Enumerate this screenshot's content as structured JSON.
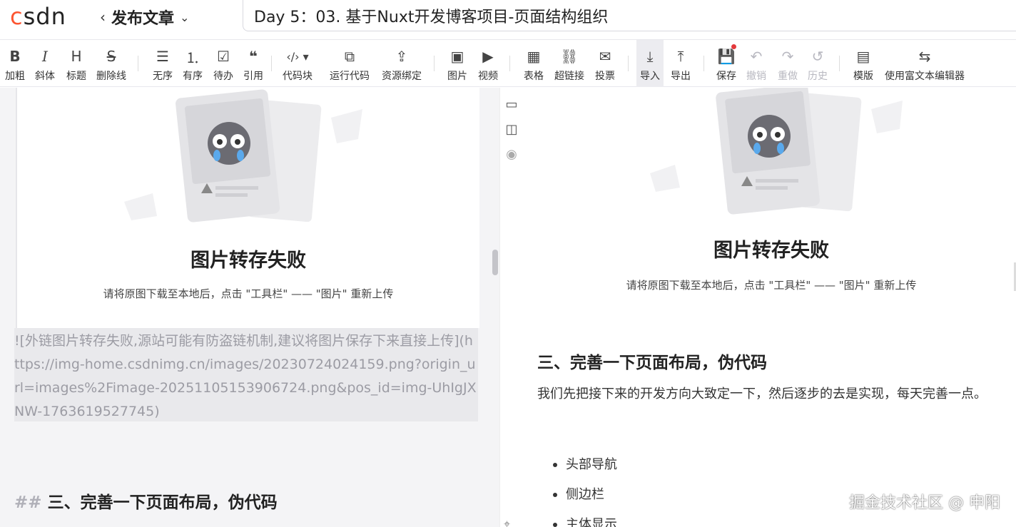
{
  "header": {
    "logo": "CSDN",
    "back_label": "发布文章",
    "article_title": "Day 5：03. 基于Nuxt开发博客项目-页面结构组织"
  },
  "toolbar": {
    "items": [
      {
        "icon": "B",
        "label": "加粗"
      },
      {
        "icon": "I",
        "label": "斜体"
      },
      {
        "icon": "H",
        "label": "标题"
      },
      {
        "icon": "S",
        "label": "删除线"
      },
      {
        "icon": "unordered-list-icon",
        "label": "无序"
      },
      {
        "icon": "ordered-list-icon",
        "label": "有序"
      },
      {
        "icon": "todo-list-icon",
        "label": "待办"
      },
      {
        "icon": "quote-icon",
        "label": "引用"
      },
      {
        "icon": "code-icon",
        "label": "代码块"
      },
      {
        "icon": "run-code-icon",
        "label": "运行代码"
      },
      {
        "icon": "resource-bind-icon",
        "label": "资源绑定"
      },
      {
        "icon": "image-icon",
        "label": "图片"
      },
      {
        "icon": "video-icon",
        "label": "视频"
      },
      {
        "icon": "table-icon",
        "label": "表格"
      },
      {
        "icon": "link-icon",
        "label": "超链接"
      },
      {
        "icon": "vote-icon",
        "label": "投票"
      },
      {
        "icon": "import-icon",
        "label": "导入"
      },
      {
        "icon": "export-icon",
        "label": "导出"
      },
      {
        "icon": "save-icon",
        "label": "保存"
      },
      {
        "icon": "undo-icon",
        "label": "撤销"
      },
      {
        "icon": "redo-icon",
        "label": "重做"
      },
      {
        "icon": "history-icon",
        "label": "历史"
      },
      {
        "icon": "template-icon",
        "label": "模版"
      },
      {
        "icon": "switch-editor-icon",
        "label": "使用富文本编辑器"
      }
    ]
  },
  "editor": {
    "fail_title": "图片转存失败",
    "fail_sub": "请将原图下载至本地后，点击 \"工具栏\" —— \"图片\" 重新上传",
    "markdown_image": "![外链图片转存失败,源站可能有防盗链机制,建议将图片保存下来直接上传](https://img-home.csdnimg.cn/images/20230724024159.png?origin_url=images%2Fimage-20251105153906724.png&pos_id=img-UhIgJXNW-1763619527745)",
    "heading_hash": "##",
    "heading_text": "三、完善一下页面布局，伪代码"
  },
  "preview": {
    "fail_title": "图片转存失败",
    "fail_sub": "请将原图下载至本地后，点击 \"工具栏\" —— \"图片\" 重新上传",
    "heading": "三、完善一下页面布局，伪代码",
    "paragraph": "我们先把接下来的开发方向大致定一下，然后逐步的去是实现，每天完善一点。",
    "list": [
      "头部导航",
      "侧边栏",
      "主体显示"
    ]
  },
  "watermark": "掘金技术社区 @ 申阳",
  "colors": {
    "brand": "#fc5531",
    "editor_bg": "#f4f4f6",
    "code_bg": "#e9e9ec",
    "active_tool_bg": "#ececf0",
    "unsaved_dot": "#e4393c"
  }
}
